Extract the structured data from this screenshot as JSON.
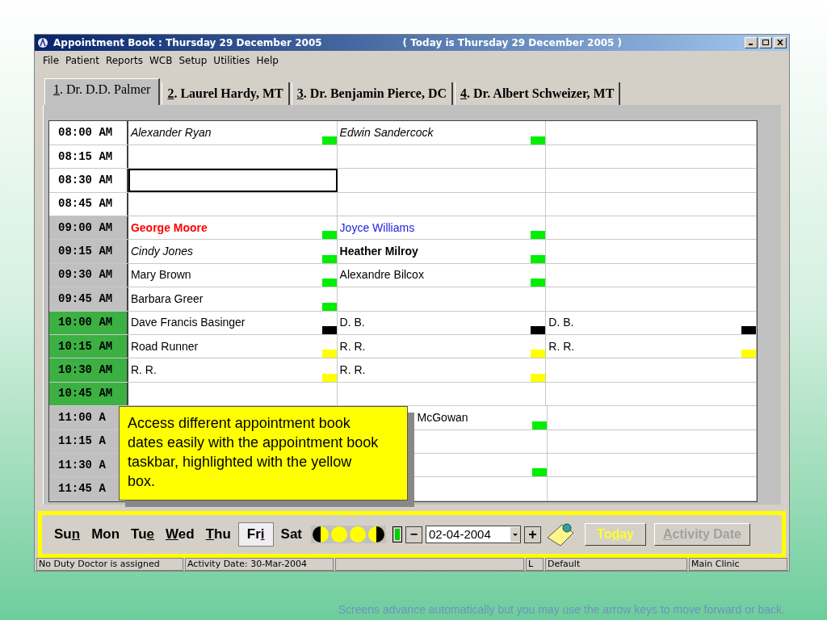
{
  "window": {
    "title": "Appointment Book : Thursday 29 December 2005",
    "today_note": "( Today is Thursday 29 December 2005 )"
  },
  "menu": [
    "File",
    "Patient",
    "Reports",
    "WCB",
    "Setup",
    "Utilities",
    "Help"
  ],
  "tabs": [
    {
      "key": "1",
      "post": ". Dr. D.D. Palmer",
      "selected": true
    },
    {
      "key": "2",
      "post": ". Laurel Hardy, MT",
      "selected": false
    },
    {
      "key": "3",
      "post": ". Dr. Benjamin Pierce, DC",
      "selected": false
    },
    {
      "key": "4",
      "post": ". Dr. Albert Schweizer, MT",
      "selected": false
    }
  ],
  "schedule": [
    {
      "time": "08:00 AM",
      "color": "#ffffff",
      "kind": "open",
      "cells": [
        {
          "name": "Alexander Ryan",
          "kind": "italic",
          "color": "#00ee00",
          "selected": false
        },
        {
          "name": "Edwin Sandercock",
          "kind": "italic",
          "color": "#00ee00",
          "selected": false
        },
        {
          "selected": false
        }
      ]
    },
    {
      "time": "08:15 AM",
      "color": "#ffffff",
      "kind": "open",
      "cells": [
        {
          "selected": false
        },
        {
          "selected": false
        },
        {
          "selected": false
        }
      ]
    },
    {
      "time": "08:30 AM",
      "color": "#ffffff",
      "kind": "open",
      "cells": [
        {
          "selected": true
        },
        {
          "selected": false
        },
        {
          "selected": false
        }
      ]
    },
    {
      "time": "08:45 AM",
      "color": "#ffffff",
      "kind": "open",
      "cells": [
        {
          "selected": false
        },
        {
          "selected": false
        },
        {
          "selected": false
        }
      ]
    },
    {
      "time": "09:00 AM",
      "color": "#c0c0c0",
      "kind": "open",
      "cells": [
        {
          "name": "George Moore",
          "kind": "red",
          "color": "#00ee00",
          "selected": false
        },
        {
          "name": "Joyce Williams",
          "kind": "blue",
          "color": "#00ee00",
          "selected": false
        },
        {
          "selected": false
        }
      ]
    },
    {
      "time": "09:15 AM",
      "color": "#c0c0c0",
      "kind": "open",
      "cells": [
        {
          "name": "Cindy Jones",
          "kind": "italic",
          "color": "#00ee00",
          "selected": false
        },
        {
          "name": "Heather Milroy",
          "kind": "bold",
          "color": "#00ee00",
          "selected": false
        },
        {
          "selected": false
        }
      ]
    },
    {
      "time": "09:30 AM",
      "color": "#c0c0c0",
      "kind": "open",
      "cells": [
        {
          "name": "Mary Brown",
          "kind": "plain",
          "color": "#00ee00",
          "selected": false
        },
        {
          "name": "Alexandre Bilcox",
          "kind": "plain",
          "color": "#00ee00",
          "selected": false
        },
        {
          "selected": false
        }
      ]
    },
    {
      "time": "09:45 AM",
      "color": "#c0c0c0",
      "kind": "open",
      "cells": [
        {
          "name": "Barbara Greer",
          "kind": "plain",
          "color": "#00ee00",
          "selected": false
        },
        {
          "selected": false
        },
        {
          "selected": false
        }
      ]
    },
    {
      "time": "10:00 AM",
      "color": "#3cb043",
      "kind": "open",
      "cells": [
        {
          "name": "Dave Francis Basinger",
          "kind": "plain",
          "color": "#000000",
          "selected": false
        },
        {
          "name": "D. B.",
          "kind": "plain",
          "color": "#000000",
          "selected": false
        },
        {
          "name": "D. B.",
          "kind": "plain",
          "color": "#000000",
          "selected": false
        }
      ]
    },
    {
      "time": "10:15 AM",
      "color": "#3cb043",
      "kind": "open",
      "cells": [
        {
          "name": "Road Runner",
          "kind": "plain",
          "color": "#ffff00",
          "selected": false
        },
        {
          "name": "R. R.",
          "kind": "plain",
          "color": "#ffff00",
          "selected": false
        },
        {
          "name": "R. R.",
          "kind": "plain",
          "color": "#ffff00",
          "selected": false
        }
      ]
    },
    {
      "time": "10:30 AM",
      "color": "#3cb043",
      "kind": "open",
      "cells": [
        {
          "name": "R. R.",
          "kind": "plain",
          "color": "#ffff00",
          "selected": false
        },
        {
          "name": "R. R.",
          "kind": "plain",
          "color": "#ffff00",
          "selected": false
        },
        {
          "selected": false
        }
      ]
    },
    {
      "time": "10:45 AM",
      "color": "#3cb043",
      "kind": "open",
      "cells": [
        {
          "selected": false
        },
        {
          "selected": false
        },
        {
          "selected": false
        }
      ]
    },
    {
      "time": "11:00 A",
      "color": "#c0c0c0",
      "kind": "covered",
      "cells": [
        {
          "name": "McGowan",
          "kind": "plain",
          "color": "#00ee00",
          "selected": false
        },
        {
          "selected": false
        }
      ]
    },
    {
      "time": "11:15 A",
      "color": "#c0c0c0",
      "kind": "covered",
      "cells": [
        {
          "selected": false
        },
        {
          "selected": false
        }
      ]
    },
    {
      "time": "11:30 A",
      "color": "#c0c0c0",
      "kind": "covered",
      "cells": [
        {
          "color": "#00ee00",
          "selected": false
        },
        {
          "selected": false
        }
      ]
    },
    {
      "time": "11:45 A",
      "color": "#c0c0c0",
      "kind": "covered",
      "cells": [
        {
          "selected": false
        },
        {
          "selected": false
        }
      ]
    }
  ],
  "callout": {
    "text": "Access different appointment book dates easily with the appointment book taskbar, highlighted with the yellow box."
  },
  "days": [
    {
      "pre": "Su",
      "key": "n",
      "selected": false
    },
    {
      "pre": "Mon",
      "selected": false
    },
    {
      "pre": "Tu",
      "key": "e",
      "selected": false
    },
    {
      "key": "W",
      "post": "ed",
      "selected": false
    },
    {
      "key": "T",
      "post": "hu",
      "selected": false
    },
    {
      "pre": "Fr",
      "key": "i",
      "selected": true
    },
    {
      "pre": "Sat",
      "selected": false
    }
  ],
  "date_field": {
    "value": "02-04-2004"
  },
  "minus": "−",
  "plus": "+",
  "today_button": {
    "pre": "To",
    "key": "d",
    "post": "ay",
    "disabled": false
  },
  "activity_button": {
    "key": "A",
    "post": "ctivity Date",
    "disabled": true
  },
  "status_bar": [
    "No Duty Doctor is assigned",
    "Activity Date: 30-Mar-2004",
    "L",
    "Default",
    "Main Clinic"
  ],
  "footer": "Screens advance automatically but you may use the arrow keys to move forward or back."
}
